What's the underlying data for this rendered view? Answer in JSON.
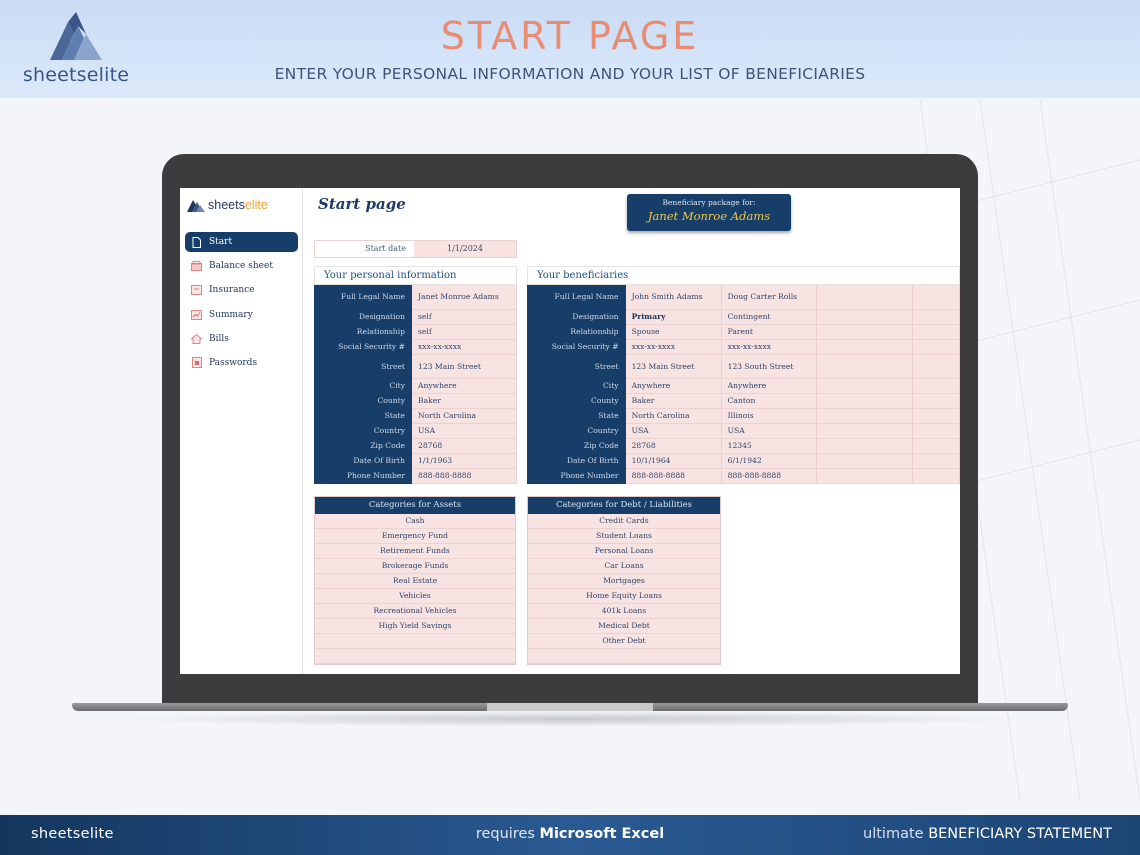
{
  "banner": {
    "brand": "sheetselite",
    "title": "START PAGE",
    "subtitle": "ENTER YOUR PERSONAL INFORMATION AND YOUR LIST OF BENEFICIARIES"
  },
  "app": {
    "logo_prefix": "sheets",
    "logo_suffix": "elite",
    "page_title": "Start page",
    "package_label": "Beneficiary package for:",
    "package_name": "Janet Monroe Adams",
    "start_date_label": "Start date",
    "start_date_value": "1/1/2024"
  },
  "sidebar": {
    "items": [
      {
        "label": "Start",
        "icon": "document-icon",
        "active": true
      },
      {
        "label": "Balance sheet",
        "icon": "wallet-icon",
        "active": false
      },
      {
        "label": "Insurance",
        "icon": "folder-icon",
        "active": false
      },
      {
        "label": "Summary",
        "icon": "chart-icon",
        "active": false
      },
      {
        "label": "Bills",
        "icon": "house-icon",
        "active": false
      },
      {
        "label": "Passwords",
        "icon": "lock-icon",
        "active": false
      }
    ]
  },
  "personal": {
    "heading": "Your personal information",
    "rows": [
      {
        "label": "Full Legal Name",
        "value": "Janet Monroe Adams"
      },
      {
        "label": "Designation",
        "value": "self"
      },
      {
        "label": "Relationship",
        "value": "self"
      },
      {
        "label": "Social Security #",
        "value": "xxx-xx-xxxx"
      },
      {
        "label": "Street",
        "value": "123 Main Street"
      },
      {
        "label": "City",
        "value": "Anywhere"
      },
      {
        "label": "County",
        "value": "Baker"
      },
      {
        "label": "State",
        "value": "North Carolina"
      },
      {
        "label": "Country",
        "value": "USA"
      },
      {
        "label": "Zip Code",
        "value": "28768"
      },
      {
        "label": "Date Of Birth",
        "value": "1/1/1963"
      },
      {
        "label": "Phone Number",
        "value": "888-888-8888"
      }
    ]
  },
  "beneficiaries": {
    "heading": "Your beneficiaries",
    "labels": [
      "Full Legal Name",
      "Designation",
      "Relationship",
      "Social Security #",
      "Street",
      "City",
      "County",
      "State",
      "Country",
      "Zip Code",
      "Date Of Birth",
      "Phone Number"
    ],
    "people": [
      [
        "John Smith Adams",
        "Primary",
        "Spouse",
        "xxx-xx-xxxx",
        "123 Main Street",
        "Anywhere",
        "Baker",
        "North Carolina",
        "USA",
        "28768",
        "10/1/1964",
        "888-888-8888"
      ],
      [
        "Doug Carter Rolls",
        "Contingent",
        "Parent",
        "xxx-xx-xxxx",
        "123 South Street",
        "Anywhere",
        "Canton",
        "Illinois",
        "USA",
        "12345",
        "6/1/1942",
        "888-888-8888"
      ]
    ]
  },
  "assets": {
    "heading": "Categories for Assets",
    "items": [
      "Cash",
      "Emergency Fund",
      "Retirement Funds",
      "Brokerage Funds",
      "Real Estate",
      "Vehicles",
      "Recreational Vehicles",
      "High Yield Savings",
      "",
      ""
    ]
  },
  "debts": {
    "heading": "Categories for Debt / Liabilities",
    "items": [
      "Credit Cards",
      "Student Loans",
      "Personal Loans",
      "Car Loans",
      "Mortgages",
      "Home Equity Loans",
      "401k Loans",
      "Medical Debt",
      "Other Debt",
      ""
    ]
  },
  "footer": {
    "left": "sheetselite",
    "mid_prefix": "requires",
    "mid_bold": "Microsoft Excel",
    "right_light": "ultimate",
    "right_bold": "BENEFICIARY STATEMENT"
  },
  "colors": {
    "navy": "#173e69",
    "pink_cell": "#f8e3e3",
    "title_coral": "#e88c74",
    "gold": "#f1c645"
  }
}
